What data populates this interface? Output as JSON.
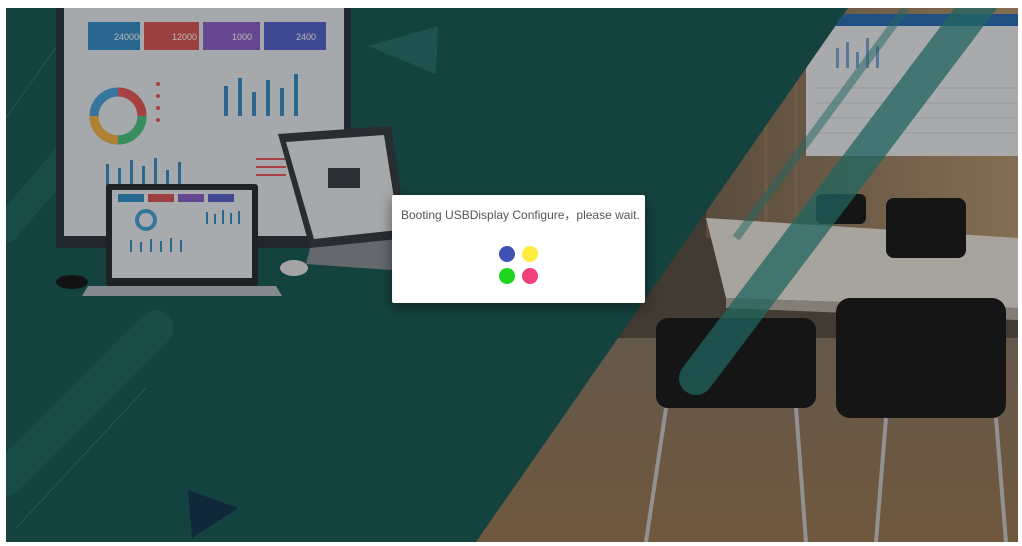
{
  "dialog": {
    "message": "Booting USBDisplay Configure，please wait..."
  },
  "spinner": {
    "dots": [
      {
        "position": "top-left",
        "color": "#3f51b5"
      },
      {
        "position": "top-right",
        "color": "#ffeb3b"
      },
      {
        "position": "bottom-left",
        "color": "#1ed61e"
      },
      {
        "position": "bottom-right",
        "color": "#f0417a"
      }
    ]
  },
  "dashboard_tiles": [
    "240000",
    "12000",
    "1000",
    "2400"
  ],
  "colors": {
    "background_teal": "#1c5d58",
    "dialog_background": "#ffffff",
    "message_text": "#555555"
  }
}
